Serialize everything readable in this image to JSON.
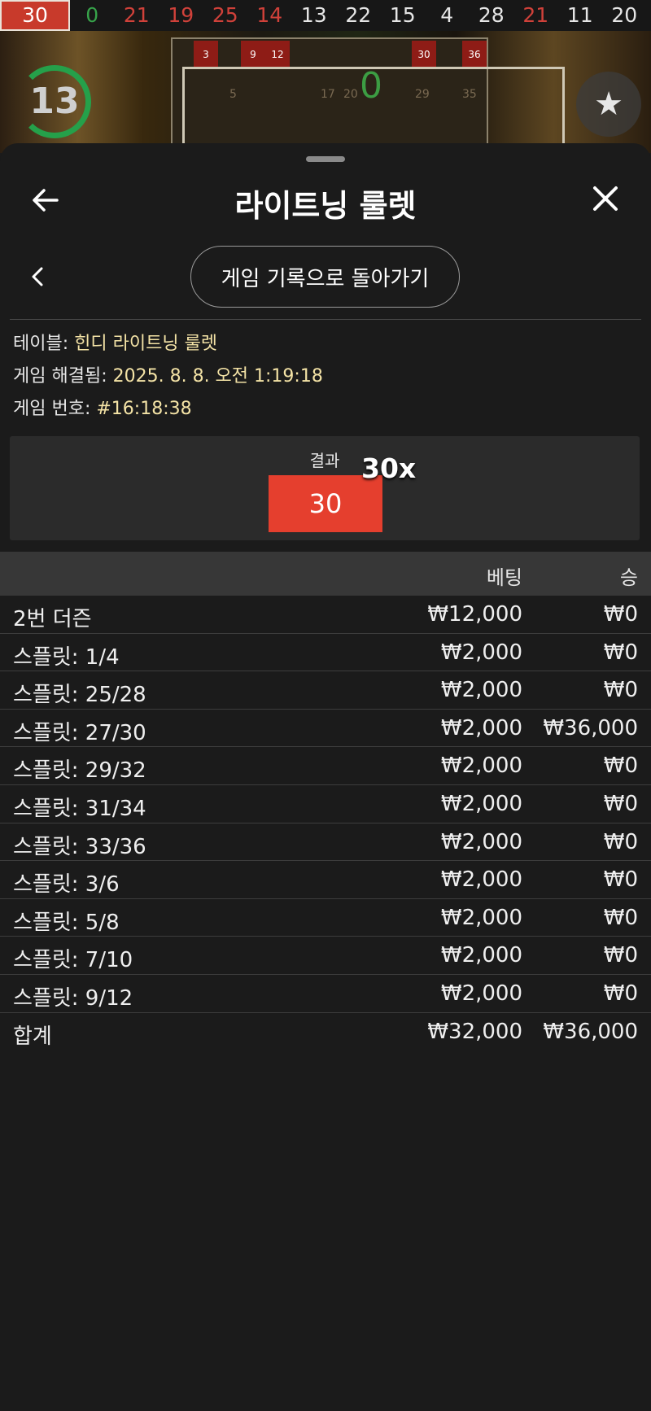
{
  "history": {
    "numbers": [
      {
        "value": "30",
        "color": "#ffffff"
      },
      {
        "value": "0",
        "color": "#37a34a"
      },
      {
        "value": "21",
        "color": "#d0413a"
      },
      {
        "value": "19",
        "color": "#d0413a"
      },
      {
        "value": "25",
        "color": "#d0413a"
      },
      {
        "value": "14",
        "color": "#d0413a"
      },
      {
        "value": "13",
        "color": "#e6e6e6"
      },
      {
        "value": "22",
        "color": "#e6e6e6"
      },
      {
        "value": "15",
        "color": "#e6e6e6"
      },
      {
        "value": "4",
        "color": "#e6e6e6"
      },
      {
        "value": "28",
        "color": "#e6e6e6"
      },
      {
        "value": "21",
        "color": "#d0413a"
      },
      {
        "value": "11",
        "color": "#e6e6e6"
      },
      {
        "value": "20",
        "color": "#e6e6e6"
      }
    ]
  },
  "game": {
    "timer": "13",
    "zero_label": "0",
    "table_cells": [
      "3",
      "9",
      "12",
      "30",
      "36"
    ],
    "table_faint": [
      "5",
      "17",
      "20",
      "29",
      "35"
    ]
  },
  "sheet": {
    "title": "라이트닝 룰렛",
    "back_history_label": "게임 기록으로 돌아가기",
    "info": {
      "table_key": "테이블:",
      "table_val": "힌디 라이트닝 룰렛",
      "resolved_key": "게임 해결됨:",
      "resolved_val": "2025. 8. 8. 오전 1:19:18",
      "game_no_key": "게임 번호:",
      "game_no_val": "#16:18:38"
    },
    "result": {
      "label": "결과",
      "number": "30",
      "multiplier": "30x"
    },
    "table": {
      "col_bet": "베팅",
      "col_win": "승",
      "rows": [
        {
          "name": "2번 더즌",
          "bet": "₩12,000",
          "win": "₩0"
        },
        {
          "name": "스플릿: 1/4",
          "bet": "₩2,000",
          "win": "₩0"
        },
        {
          "name": "스플릿: 25/28",
          "bet": "₩2,000",
          "win": "₩0"
        },
        {
          "name": "스플릿: 27/30",
          "bet": "₩2,000",
          "win": "₩36,000"
        },
        {
          "name": "스플릿: 29/32",
          "bet": "₩2,000",
          "win": "₩0"
        },
        {
          "name": "스플릿: 31/34",
          "bet": "₩2,000",
          "win": "₩0"
        },
        {
          "name": "스플릿: 33/36",
          "bet": "₩2,000",
          "win": "₩0"
        },
        {
          "name": "스플릿: 3/6",
          "bet": "₩2,000",
          "win": "₩0"
        },
        {
          "name": "스플릿: 5/8",
          "bet": "₩2,000",
          "win": "₩0"
        },
        {
          "name": "스플릿: 7/10",
          "bet": "₩2,000",
          "win": "₩0"
        },
        {
          "name": "스플릿: 9/12",
          "bet": "₩2,000",
          "win": "₩0"
        }
      ],
      "total": {
        "name": "합계",
        "bet": "₩32,000",
        "win": "₩36,000"
      }
    }
  },
  "colors": {
    "accent_red": "#e53f2e",
    "info_value": "#f4e3a6",
    "sheet_bg": "#1b1b1b"
  }
}
